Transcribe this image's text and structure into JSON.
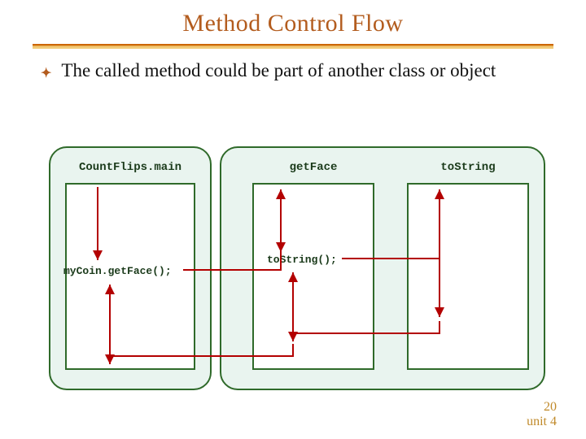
{
  "title": "Method Control Flow",
  "bullet_icon": "✦",
  "bullet": "The called method could be part of another class or object",
  "labels": {
    "a": "CountFlips.main",
    "b": "getFace",
    "c": "toString"
  },
  "calls": {
    "x": "myCoin.getFace();",
    "y": "toString();"
  },
  "footer": {
    "page": "20",
    "unit": "unit 4"
  },
  "chart_data": {
    "type": "diagram",
    "title": "Method Control Flow",
    "annotations": [
      "The called method could be part of another class or object"
    ],
    "panels": [
      {
        "name": "class-or-object-left"
      },
      {
        "name": "class-or-object-right"
      }
    ],
    "boxes": [
      {
        "id": "CountFlips.main",
        "panel": "left"
      },
      {
        "id": "getFace",
        "panel": "right"
      },
      {
        "id": "toString",
        "panel": "right"
      }
    ],
    "calls": [
      {
        "from": "CountFlips.main",
        "to": "getFace",
        "label": "myCoin.getFace();"
      },
      {
        "from": "getFace",
        "to": "toString",
        "label": "toString();"
      }
    ],
    "returns": [
      {
        "from": "toString",
        "to": "getFace"
      },
      {
        "from": "getFace",
        "to": "CountFlips.main"
      }
    ]
  }
}
